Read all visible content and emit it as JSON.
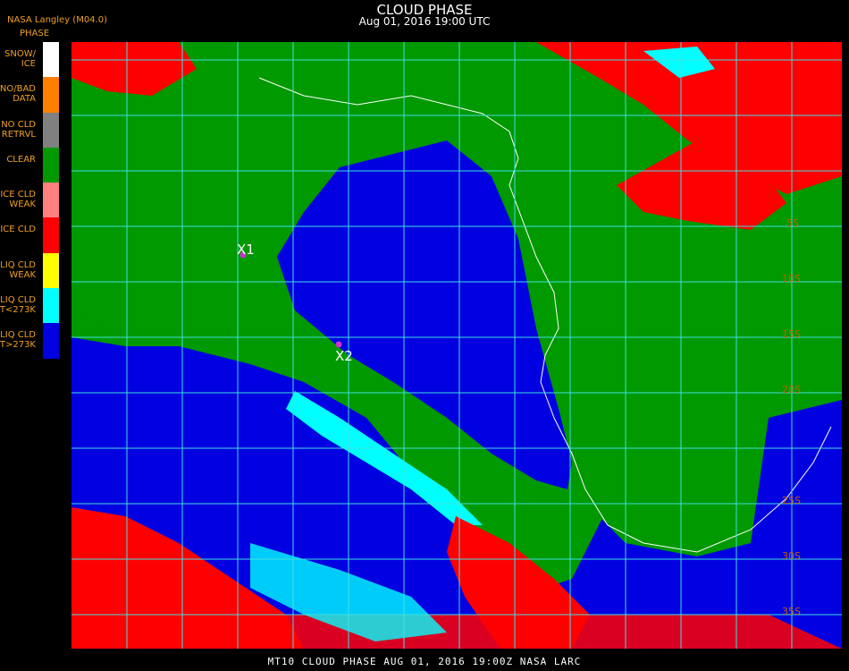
{
  "header": {
    "title": "CLOUD PHASE",
    "datetime": "Aug 01, 2016 19:00 UTC",
    "organization": "NASA Langley (M04.0)",
    "legend_title": "PHASE"
  },
  "legend": [
    {
      "label": "SNOW/\nICE",
      "color": "#ffffff"
    },
    {
      "label": "NO/BAD\nDATA",
      "color": "#ff8000"
    },
    {
      "label": "NO CLD\nRETRVL",
      "color": "#808080"
    },
    {
      "label": "CLEAR",
      "color": "#009900"
    },
    {
      "label": "ICE CLD\nWEAK",
      "color": "#ff8080"
    },
    {
      "label": "ICE CLD",
      "color": "#ff0000"
    },
    {
      "label": "LIQ CLD\nWEAK",
      "color": "#ffff00"
    },
    {
      "label": "LIQ CLD\nT<273K",
      "color": "#00ffff"
    },
    {
      "label": "LIQ CLD\nT>273K",
      "color": "#0000e0"
    }
  ],
  "markers": [
    {
      "label": "X1",
      "color": "#cc33cc"
    },
    {
      "label": "X2",
      "color": "#cc33cc"
    }
  ],
  "latitude_labels": [
    "5S",
    "10S",
    "15S",
    "20S",
    "25S",
    "30S",
    "35S"
  ],
  "footer": "MT10  CLOUD PHASE   AUG 01, 2016 19:00Z   NASA LARC",
  "colors": {
    "land_clear": "#009900",
    "ocean_liquid": "#0000e0",
    "ice_cloud": "#ff0000",
    "cold_liquid": "#00ffff",
    "grid": "#40e0e0",
    "coastline": "#ffffff",
    "label_orange": "#f0a020"
  }
}
